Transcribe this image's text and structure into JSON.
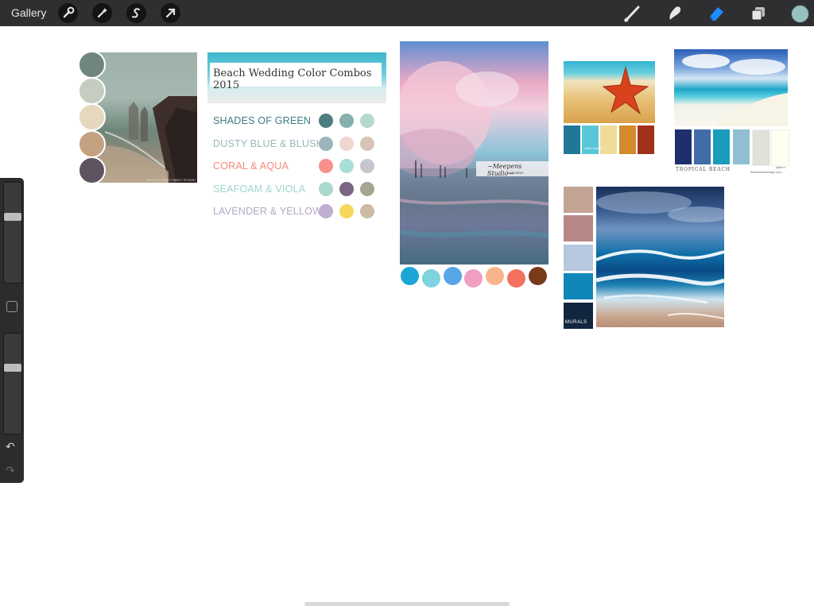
{
  "toolbar": {
    "gallery_label": "Gallery",
    "left_tools": [
      "wrench-icon",
      "magic-wand-icon",
      "selection-s-icon",
      "transform-arrow-icon"
    ],
    "right_tools": [
      "brush-icon",
      "smudge-icon",
      "eraser-icon",
      "layers-icon"
    ],
    "active_color": "#97c1c1"
  },
  "sidebar": {
    "brush_size_level": 0.33,
    "opacity_level": 0.33
  },
  "collage1": {
    "swatches": [
      "#6f8580",
      "#c4cdbf",
      "#e6d7bf",
      "#c2a281",
      "#5e5461"
    ],
    "photo_credit": "PHOTO CREDIT: FANCY STUDIO"
  },
  "combos": {
    "title": "Beach Wedding Color Combos 2015",
    "rows": [
      {
        "label": "SHADES OF GREEN",
        "color": "#3f7b7f",
        "dots": [
          "#4d7d80",
          "#85b0ad",
          "#b5d8cf"
        ]
      },
      {
        "label": "DUSTY BLUE & BLUSH",
        "color": "#9cb5bb",
        "dots": [
          "#9cb5bb",
          "#efd6d3",
          "#d8c4b6"
        ]
      },
      {
        "label": "CORAL & AQUA",
        "color": "#f4877d",
        "dots": [
          "#f8908b",
          "#a9dfd6",
          "#c8c5cf"
        ]
      },
      {
        "label": "SEAFOAM & VIOLA",
        "color": "#9fd6cc",
        "dots": [
          "#acd9cf",
          "#7b6582",
          "#a6a492"
        ]
      },
      {
        "label": "LAVENDER & YELLOW",
        "color": "#b3a7c5",
        "dots": [
          "#bfaed0",
          "#f7d85c",
          "#cbbba4"
        ]
      }
    ]
  },
  "collage3": {
    "watermark_line1": "~Meepens Studio~",
    "watermark_line2": "inspiration",
    "dots": [
      "#1ba6d6",
      "#7dd3de",
      "#58a6e8",
      "#f09fc2",
      "#f8b48c",
      "#f2705d",
      "#7a3a1c"
    ]
  },
  "collage4": {
    "swatches": [
      "#1e7896",
      "#5ac7d9",
      "#efdc99",
      "#d6892a",
      "#a0311b"
    ],
    "swatch_label": "Color Cruise"
  },
  "collage5": {
    "swatches": [
      "#1e2f6e",
      "#416ca7",
      "#1b9bbd",
      "#8fbfd1",
      "#e1e1da",
      "#fffff1"
    ],
    "caption_left": "TROPICAL BEACH",
    "caption_right1": "@kern",
    "caption_right2": "freemarketdesign.com"
  },
  "collage6": {
    "swatches": [
      "#c3a393",
      "#b88888",
      "#b6c7de",
      "#1186b9",
      "#12253e"
    ],
    "label": "MURALS"
  }
}
